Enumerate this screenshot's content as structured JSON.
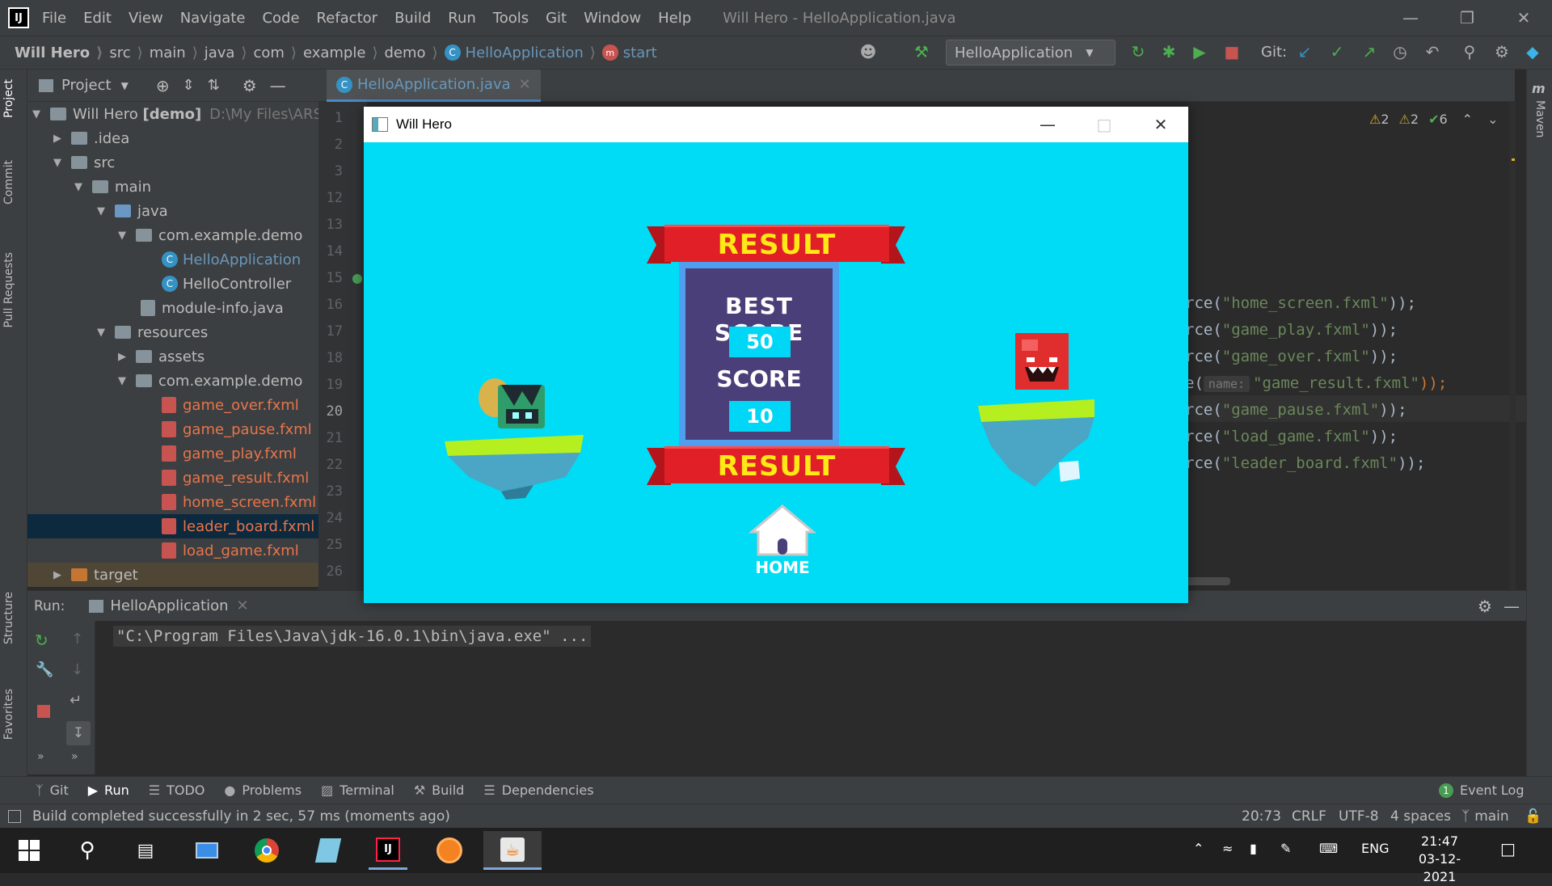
{
  "ide": {
    "menu": [
      "File",
      "Edit",
      "View",
      "Navigate",
      "Code",
      "Refactor",
      "Build",
      "Run",
      "Tools",
      "Git",
      "Window",
      "Help"
    ],
    "window_title": "Will Hero - HelloApplication.java",
    "breadcrumbs": [
      "Will Hero",
      "src",
      "main",
      "java",
      "com",
      "example",
      "demo",
      "HelloApplication",
      "start"
    ],
    "run_config": "HelloApplication",
    "git_label": "Git:",
    "project_label": "Project",
    "editor_tab": "HelloApplication.java",
    "inspections": {
      "warn1": "2",
      "warn2": "2",
      "ok": "6"
    },
    "left_strip": [
      "Project",
      "Commit",
      "Pull Requests",
      "Structure",
      "Favorites"
    ],
    "right_strip": [
      "Maven"
    ],
    "tree": [
      {
        "label": "Will Hero",
        "bold_suffix": "[demo]",
        "path": "D:\\My Files\\ARS@"
      },
      {
        "label": ".idea"
      },
      {
        "label": "src"
      },
      {
        "label": "main"
      },
      {
        "label": "java"
      },
      {
        "label": "com.example.demo"
      },
      {
        "label": "HelloApplication"
      },
      {
        "label": "HelloController"
      },
      {
        "label": "module-info.java"
      },
      {
        "label": "resources"
      },
      {
        "label": "assets"
      },
      {
        "label": "com.example.demo"
      },
      {
        "label": "game_over.fxml"
      },
      {
        "label": "game_pause.fxml"
      },
      {
        "label": "game_play.fxml"
      },
      {
        "label": "game_result.fxml"
      },
      {
        "label": "home_screen.fxml"
      },
      {
        "label": "leader_board.fxml"
      },
      {
        "label": "load_game.fxml"
      },
      {
        "label": "target"
      }
    ],
    "line_numbers": [
      "1",
      "2",
      "3",
      "12",
      "13",
      "14",
      "15",
      "16",
      "17",
      "18",
      "19",
      "20",
      "21",
      "22",
      "23",
      "24",
      "25",
      "26"
    ],
    "code_lines": [
      {
        "prefix": "rce(",
        "str": "\"home_screen.fxml\"",
        "suffix": "));"
      },
      {
        "prefix": "rce(",
        "str": "\"game_play.fxml\"",
        "suffix": "));"
      },
      {
        "prefix": "rce(",
        "str": "\"game_over.fxml\"",
        "suffix": "));"
      },
      {
        "prefix": "e(",
        "hint": "name:",
        "str": "\"game_result.fxml\"",
        "suffix": "));"
      },
      {
        "prefix": "rce(",
        "str": "\"game_pause.fxml\"",
        "suffix": "));"
      },
      {
        "prefix": "rce(",
        "str": "\"load_game.fxml\"",
        "suffix": "));"
      },
      {
        "prefix": "rce(",
        "str": "\"leader_board.fxml\"",
        "suffix": "));"
      }
    ],
    "run_label": "Run:",
    "run_tab": "HelloApplication",
    "console": "\"C:\\Program Files\\Java\\jdk-16.0.1\\bin\\java.exe\" ...",
    "bottom_tabs": [
      "Git",
      "Run",
      "TODO",
      "Problems",
      "Terminal",
      "Build",
      "Dependencies"
    ],
    "event_log": "Event Log",
    "status_message": "Build completed successfully in 2 sec, 57 ms (moments ago)",
    "status_right": {
      "position": "20:73",
      "line_sep": "CRLF",
      "encoding": "UTF-8",
      "indent": "4 spaces",
      "branch": "main"
    }
  },
  "game": {
    "title": "Will Hero",
    "banner_top": "RESULT",
    "banner_bottom": "RESULT",
    "best_score_label": "BEST SCORE",
    "best_score": "50",
    "score_label": "SCORE",
    "score": "10",
    "home_label": "HOME"
  },
  "taskbar": {
    "language": "ENG",
    "time": "21:47",
    "date": "03-12-2021"
  },
  "colors": {
    "game_bg": "#00dcf5",
    "banner_red": "#e01f26",
    "banner_text": "#ffe815",
    "panel": "#4a3f78"
  }
}
